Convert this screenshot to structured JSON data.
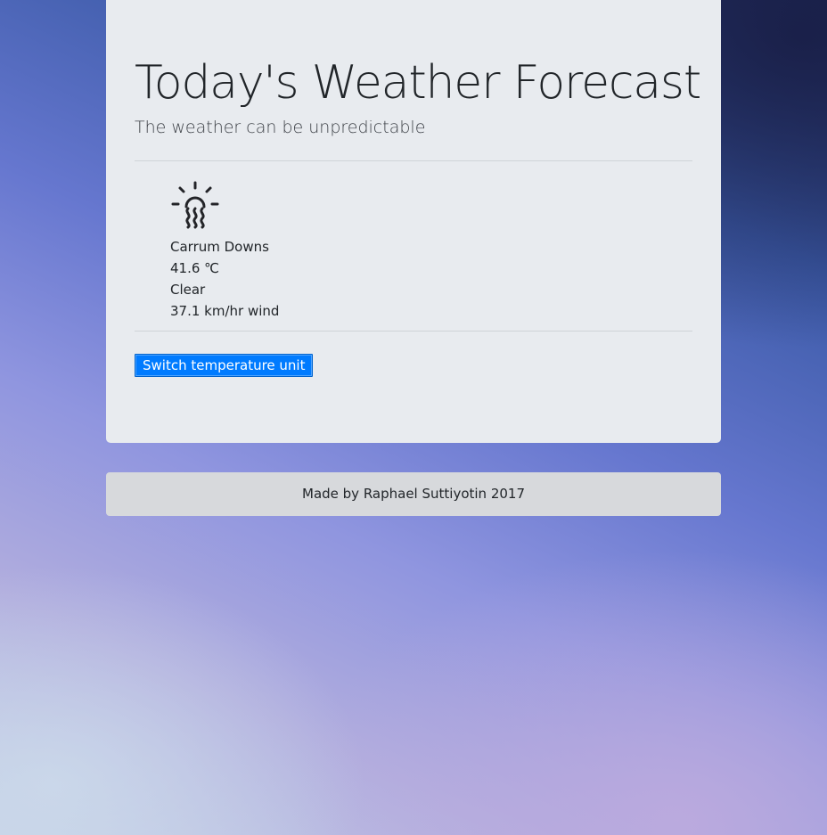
{
  "header": {
    "title": "Today's Weather Forecast",
    "subtitle": "The weather can be unpredictable"
  },
  "weather": {
    "icon": "hot-sun-heat-icon",
    "location": "Carrum Downs",
    "temperature": "41.6 ℃",
    "condition": "Clear",
    "wind": "37.1 km/hr wind"
  },
  "controls": {
    "switch_unit_label": "Switch temperature unit"
  },
  "footer": {
    "credit": "Made by Raphael Suttiyotin 2017"
  },
  "colors": {
    "button": "#007bff",
    "card": "#e8ebef",
    "footer": "#d7d9dc"
  }
}
